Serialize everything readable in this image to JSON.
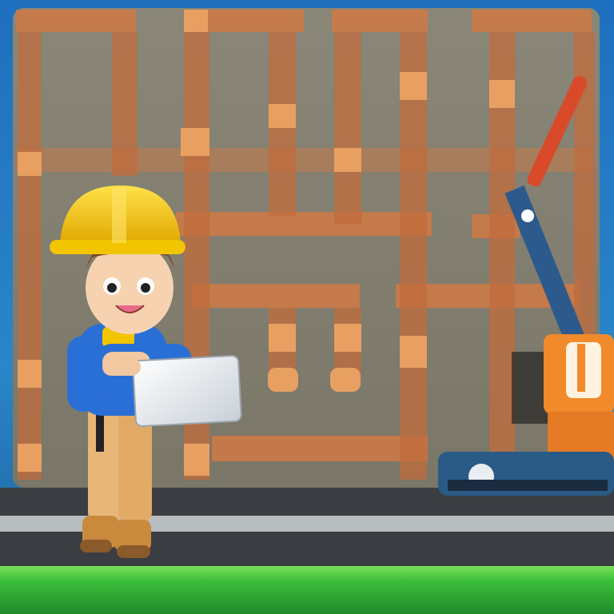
{
  "scene": {
    "title": "",
    "palette": {
      "sky": "#1c6fb8",
      "wall": "#8f8a7c",
      "brick": "#d6824a",
      "brick_dark": "#b85c34",
      "road": "#3a3d42",
      "curb": "#cfd3d6",
      "grass": "#39b83a",
      "helmet": "#f2c500",
      "shirt": "#2a6fd6",
      "pants": "#e8b677",
      "tablet": "#e9eef2",
      "machine_orange": "#f08a2a",
      "machine_blue": "#2d5a8c"
    },
    "icons": [
      "worker-character",
      "tablet-icon",
      "crane-arm",
      "excavator-machine"
    ]
  }
}
